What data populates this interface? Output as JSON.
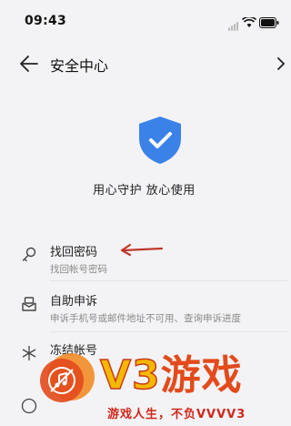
{
  "status_bar": {
    "time": "09:43"
  },
  "nav": {
    "title": "安全中心"
  },
  "hero": {
    "slogan": "用心守护  放心使用"
  },
  "items": [
    {
      "title": "找回密码",
      "subtitle": "找回帐号密码"
    },
    {
      "title": "自助申诉",
      "subtitle": "申诉手机号或邮件地址不可用、查询申诉进度"
    },
    {
      "title": "冻结帐号",
      "subtitle": ""
    }
  ],
  "watermark": {
    "brand": "V3",
    "brand_suffix": "游戏",
    "tagline": "游戏人生，不负VVVV3"
  },
  "colors": {
    "shield": "#3b82e8",
    "arrow": "#c0392b",
    "watermark_red": "#e34a1c",
    "watermark_yellow": "#f5b800"
  }
}
